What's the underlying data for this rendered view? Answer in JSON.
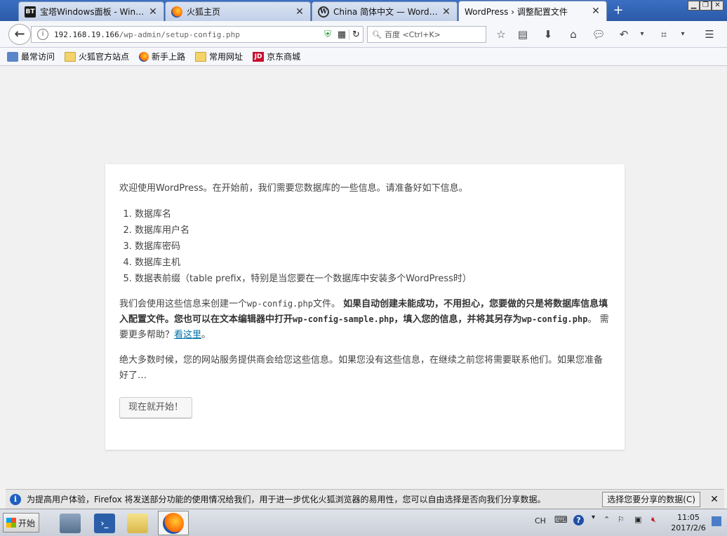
{
  "tabs": [
    {
      "label": "宝塔Windows面板 - Windo…",
      "favicon": "BT"
    },
    {
      "label": "火狐主页",
      "favicon": ""
    },
    {
      "label": "China 简体中文 — WordP…",
      "favicon": "W"
    },
    {
      "label": "WordPress › 调整配置文件",
      "favicon": ""
    }
  ],
  "navbar": {
    "url_host": "192.168.19.166",
    "url_path": "/wp-admin/setup-config.php",
    "search_placeholder": "百度 <Ctrl+K>"
  },
  "bookmarks": [
    {
      "label": "最常访问",
      "icon": "most-visited-icon"
    },
    {
      "label": "火狐官方站点",
      "icon": "folder-icon"
    },
    {
      "label": "新手上路",
      "icon": "firefox-icon"
    },
    {
      "label": "常用网址",
      "icon": "folder-icon"
    },
    {
      "label": "京东商城",
      "icon": "jd-icon",
      "badge": "JD"
    }
  ],
  "content": {
    "intro": "欢迎使用WordPress。在开始前，我们需要您数据库的一些信息。请准备好如下信息。",
    "list": [
      "数据库名",
      "数据库用户名",
      "数据库密码",
      "数据库主机",
      "数据表前缀（table prefix，特别是当您要在一个数据库中安装多个WordPress时）"
    ],
    "para2_a": "我们会使用这些信息来创建一个",
    "para2_code1": "wp-config.php",
    "para2_b": "文件。",
    "para2_strong_a": "如果自动创建未能成功，不用担心，您要做的只是将数据库信息填入配置文件。您也可以在文本编辑器中打开",
    "para2_code2": "wp-config-sample.php",
    "para2_strong_b": "，填入您的信息，并将其另存为",
    "para2_code3": "wp-config.php",
    "para2_c": "。 需要更多帮助？",
    "para2_link": "看这里",
    "para2_d": "。",
    "para3": "绝大多数时候，您的网站服务提供商会给您这些信息。如果您没有这些信息，在继续之前您将需要联系他们。如果您准备好了…",
    "button": "现在就开始！"
  },
  "notification": {
    "text": "为提高用户体验，Firefox 将发送部分功能的使用情况给我们，用于进一步优化火狐浏览器的易用性，您可以自由选择是否向我们分享数据。",
    "button": "选择您要分享的数据(C)"
  },
  "taskbar": {
    "start": "开始",
    "lang": "CH",
    "time": "11:05",
    "date": "2017/2/6"
  }
}
